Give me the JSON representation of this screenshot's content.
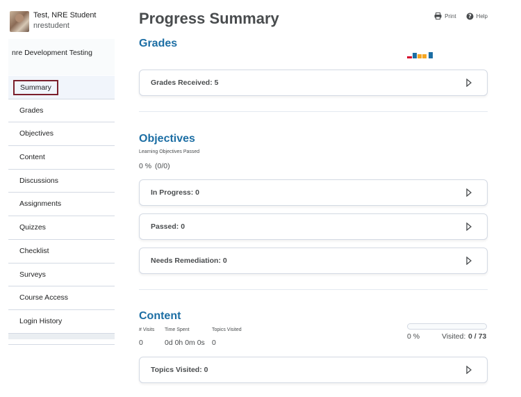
{
  "user": {
    "name": "Test, NRE Student",
    "login": "nrestudent"
  },
  "org": {
    "name": "nre Development Testing"
  },
  "nav": {
    "items": [
      {
        "label": "Summary",
        "selected": true
      },
      {
        "label": "Grades"
      },
      {
        "label": "Objectives"
      },
      {
        "label": "Content"
      },
      {
        "label": "Discussions"
      },
      {
        "label": "Assignments"
      },
      {
        "label": "Quizzes"
      },
      {
        "label": "Checklist"
      },
      {
        "label": "Surveys"
      },
      {
        "label": "Course Access"
      },
      {
        "label": "Login History"
      }
    ]
  },
  "page": {
    "title": "Progress Summary"
  },
  "toolbar": {
    "print_label": "Print",
    "print_icon": "printer-icon",
    "help_label": "Help",
    "help_icon": "question-circle-icon"
  },
  "grades": {
    "title": "Grades",
    "received_label": "Grades Received: 5",
    "chart_colors": [
      "#d6002a",
      "#1c6ea4",
      "#f5a623",
      "#1c6ea4"
    ]
  },
  "objectives": {
    "title": "Objectives",
    "passed_caption": "Learning Objectives Passed",
    "percent": "0 %",
    "fraction": "(0/0)",
    "rows": [
      {
        "label": "In Progress: 0"
      },
      {
        "label": "Passed: 0"
      },
      {
        "label": "Needs Remediation: 0"
      }
    ]
  },
  "content": {
    "title": "Content",
    "visits_label": "# Visits",
    "visits_value": "0",
    "time_label": "Time Spent",
    "time_value": "0d 0h 0m 0s",
    "topics_label": "Topics Visited",
    "topics_value": "0",
    "progress_percent": "0 %",
    "visited_label": "Visited:",
    "visited_value": "0 / 73",
    "progress_fraction": 0,
    "topics_visited_row": "Topics Visited: 0"
  },
  "colors": {
    "accent": "#1c6ea4",
    "selected_outline": "#7b1f2b",
    "border": "#d3d9e3"
  }
}
